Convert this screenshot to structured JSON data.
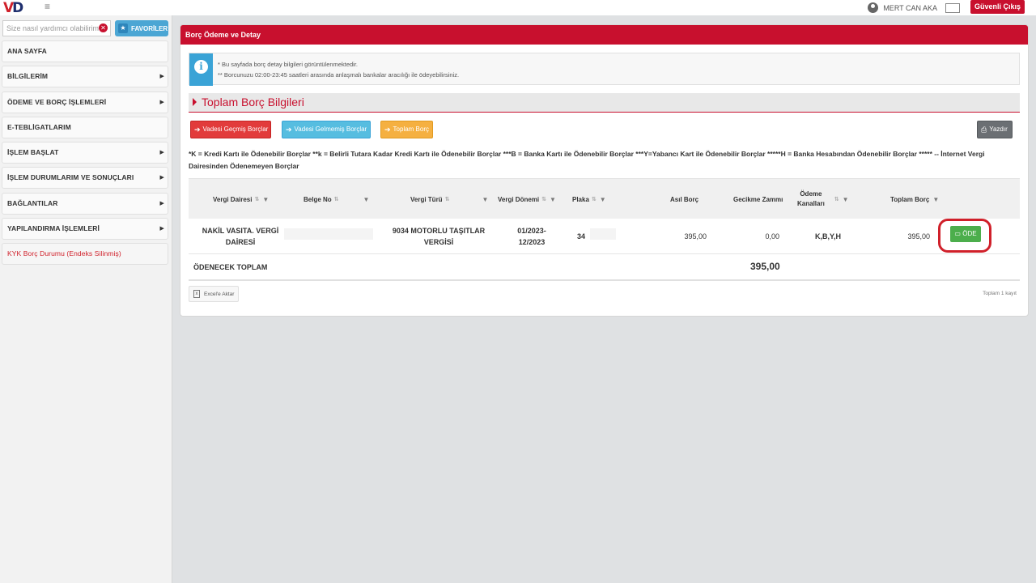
{
  "topbar": {
    "logo_v": "V",
    "logo_d": "D",
    "menu_icon": "hamburger-icon",
    "user_name": "MERT CAN AKA",
    "logout_label": "Güvenli Çıkış"
  },
  "sidebar": {
    "search_placeholder": "Size nasıl yardımcı olabilirim?",
    "favorites_label": "FAVORİLER",
    "items": [
      {
        "label": "ANA SAYFA",
        "arrow": ""
      },
      {
        "label": "BİLGİLERİM",
        "arrow": "▶"
      },
      {
        "label": "ÖDEME VE BORÇ İŞLEMLERİ",
        "arrow": "▶"
      },
      {
        "label": "E-TEBLİGATLARIM",
        "arrow": ""
      },
      {
        "label": "İŞLEM BAŞLAT",
        "arrow": "▶"
      },
      {
        "label": "İŞLEM DURUMLARIM VE SONUÇLARI",
        "arrow": "▶"
      },
      {
        "label": "BAĞLANTILAR",
        "arrow": "▶"
      },
      {
        "label": "YAPILANDIRMA İŞLEMLERİ",
        "arrow": "▶"
      },
      {
        "label": "KYK Borç Durumu (Endeks Silinmiş)",
        "arrow": ""
      }
    ]
  },
  "panel": {
    "header": "Borç Ödeme ve Detay",
    "info_line1": "* Bu sayfada borç detay bilgileri görüntülenmektedir.",
    "info_line2": "** Borcunuzu 02:00-23:45 saatleri arasında anlaşmalı bankalar aracılığı ile ödeyebilirsiniz.",
    "section_title": "Toplam Borç Bilgileri",
    "btn_overdue": "Vadesi Geçmiş Borçlar",
    "btn_not_due": "Vadesi Gelmemiş Borçlar",
    "btn_total": "Toplam Borç",
    "btn_print": "Yazdır",
    "legend": "*K = Kredi Kartı ile Ödenebilir Borçlar **k = Belirli Tutara Kadar Kredi Kartı ile Ödenebilir Borçlar ***B = Banka Kartı ile Ödenebilir Borçlar ***Y=Yabancı Kart ile Ödenebilir Borçlar *****H = Banka Hesabından Ödenebilir Borçlar ***** -- İnternet Vergi Dairesinden Ödenemeyen Borçlar"
  },
  "table": {
    "headers": {
      "office": "Vergi Dairesi",
      "doc_no": "Belge No",
      "tax_type": "Vergi Türü",
      "period": "Vergi Dönemi",
      "plate": "Plaka",
      "principal": "Asıl Borç",
      "late_fee": "Gecikme Zammı",
      "channels_1": "Ödeme",
      "channels_2": "Kanalları",
      "total": "Toplam Borç"
    },
    "row": {
      "office_1": "NAKİL VASITA. VERGİ",
      "office_2": "DAİRESİ",
      "tax_type_1": "9034 MOTORLU TAŞITLAR",
      "tax_type_2": "VERGİSİ",
      "period_1": "01/2023-",
      "period_2": "12/2023",
      "plate": "34",
      "principal": "395,00",
      "late_fee": "0,00",
      "channels": "K,B,Y,H",
      "total": "395,00",
      "pay_label": "ÖDE"
    },
    "total_label": "ÖDENECEK TOPLAM",
    "total_value": "395,00",
    "excel_label": "Excel'e Aktar",
    "record_count": "Toplam 1 kayıt"
  }
}
